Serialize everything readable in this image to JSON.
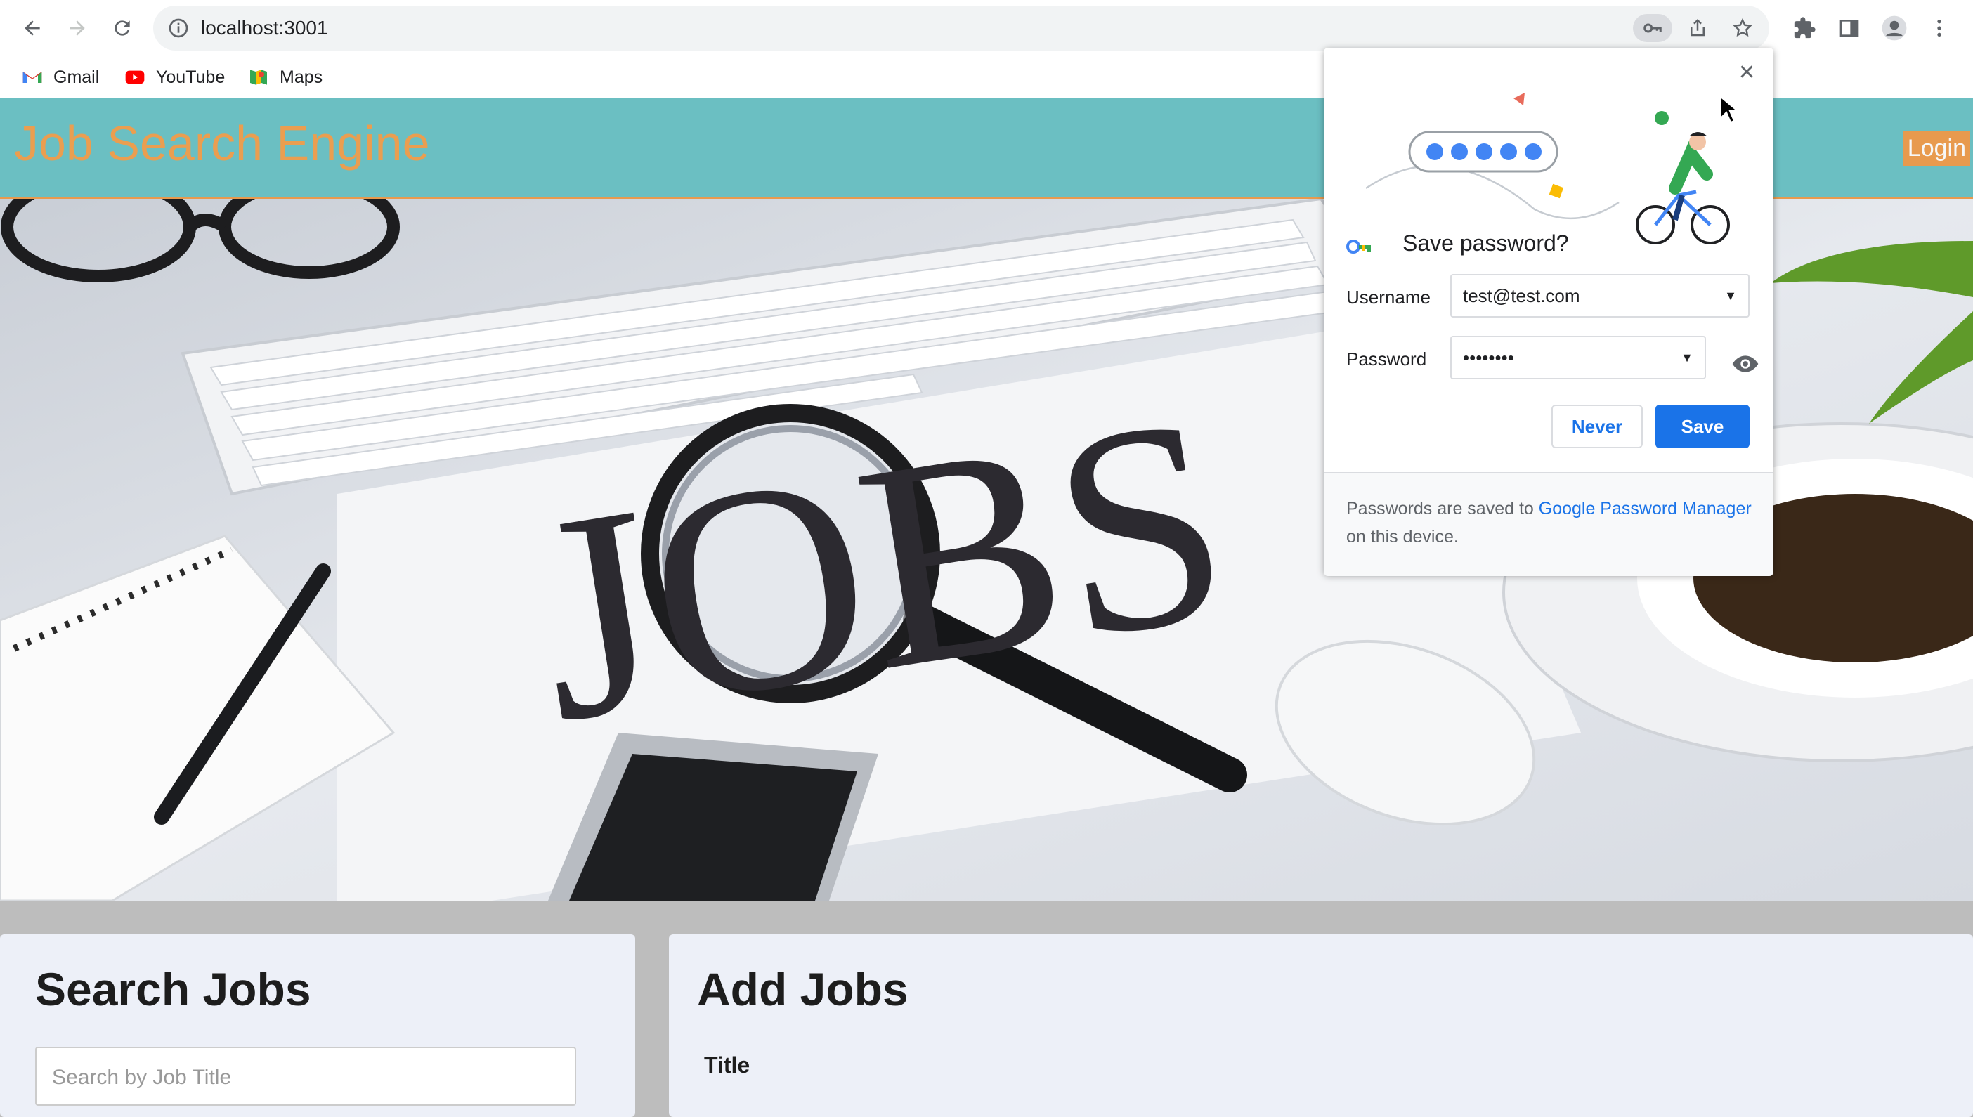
{
  "browser": {
    "url": "localhost:3001",
    "bookmarks": [
      {
        "label": "Gmail",
        "icon": "gmail-icon"
      },
      {
        "label": "YouTube",
        "icon": "youtube-icon"
      },
      {
        "label": "Maps",
        "icon": "maps-icon"
      }
    ]
  },
  "site": {
    "title": "Job Search Engine",
    "login_label": "Login",
    "hero_word": "JOBS"
  },
  "search_panel": {
    "heading": "Search Jobs",
    "placeholder": "Search by Job Title"
  },
  "add_panel": {
    "heading": "Add Jobs",
    "title_label": "Title"
  },
  "password_bubble": {
    "title": "Save password?",
    "username_label": "Username",
    "username_value": "test@test.com",
    "password_label": "Password",
    "password_value": "••••••••",
    "never_label": "Never",
    "save_label": "Save",
    "footer_prefix": "Passwords are saved to ",
    "footer_link": "Google Password Manager",
    "footer_suffix": " on this device."
  },
  "colors": {
    "header_bg": "#6bbfc2",
    "title_color": "#ea9e50",
    "login_bg": "#e89a4e",
    "accent_blue": "#1a73e8"
  }
}
